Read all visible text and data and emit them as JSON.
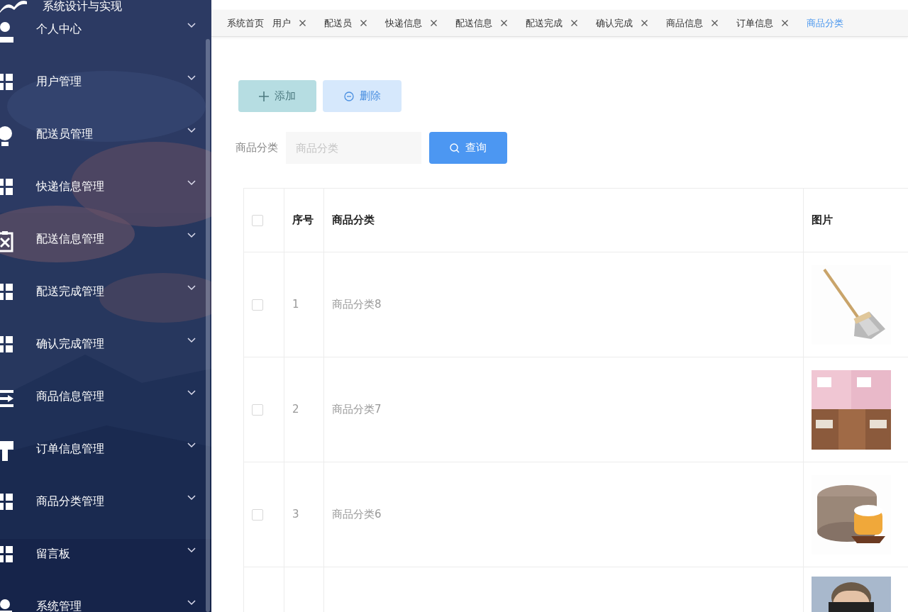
{
  "sidebar": {
    "title": "系统设计与实现",
    "items": [
      {
        "label": "个人中心",
        "expanded": false
      },
      {
        "label": "用户管理",
        "expanded": false
      },
      {
        "label": "配送员管理",
        "expanded": false
      },
      {
        "label": "快递信息管理",
        "expanded": false
      },
      {
        "label": "配送信息管理",
        "expanded": false
      },
      {
        "label": "配送完成管理",
        "expanded": false
      },
      {
        "label": "确认完成管理",
        "expanded": false
      },
      {
        "label": "商品信息管理",
        "expanded": false
      },
      {
        "label": "订单信息管理",
        "expanded": false
      },
      {
        "label": "商品分类管理",
        "expanded": false
      },
      {
        "label": "留言板",
        "expanded": false
      },
      {
        "label": "系统管理",
        "expanded": false
      }
    ]
  },
  "tabs": [
    {
      "label": "系统首页",
      "selected": false,
      "closable": false
    },
    {
      "label": "用户",
      "selected": false,
      "closable": true
    },
    {
      "label": "配送员",
      "selected": false,
      "closable": true
    },
    {
      "label": "快递信息",
      "selected": false,
      "closable": true
    },
    {
      "label": "配送信息",
      "selected": false,
      "closable": true
    },
    {
      "label": "配送完成",
      "selected": false,
      "closable": true
    },
    {
      "label": "确认完成",
      "selected": false,
      "closable": true
    },
    {
      "label": "商品信息",
      "selected": false,
      "closable": true
    },
    {
      "label": "订单信息",
      "selected": false,
      "closable": true
    },
    {
      "label": "商品分类",
      "selected": true,
      "closable": false
    }
  ],
  "actions": [
    {
      "kind": "add",
      "label": "添加"
    },
    {
      "kind": "delete",
      "label": "删除"
    }
  ],
  "search": {
    "label": "商品分类",
    "placeholder": "商品分类",
    "button": "查询"
  },
  "table": {
    "select_all": {
      "checked": false
    },
    "columns": [
      "序号",
      "商品分类",
      "图片"
    ],
    "rows": [
      {
        "index": "1",
        "name": "商品分类8",
        "selected": false
      },
      {
        "index": "2",
        "name": "商品分类7",
        "selected": false
      },
      {
        "index": "3",
        "name": "商品分类6",
        "selected": false
      },
      {
        "kind": "partial"
      }
    ]
  }
}
